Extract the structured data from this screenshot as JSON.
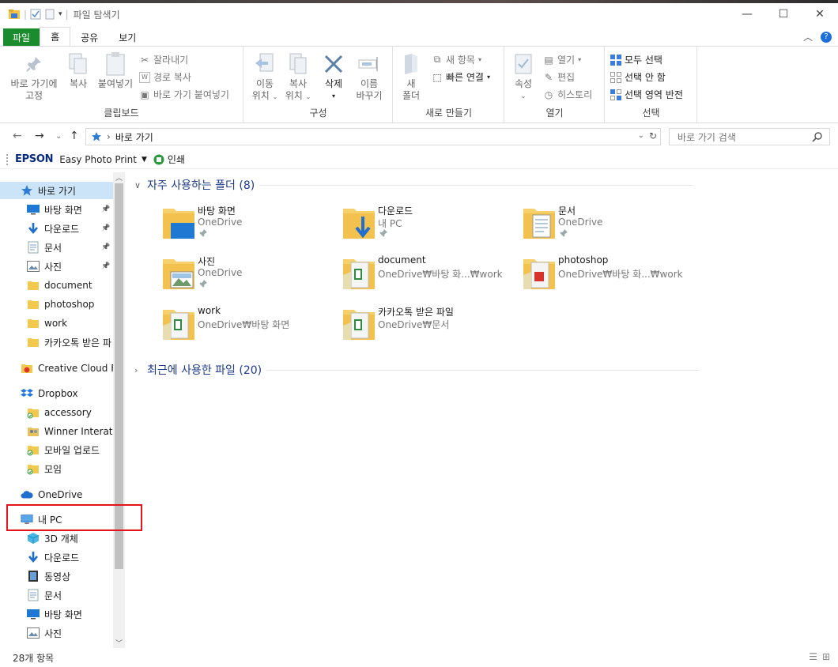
{
  "window": {
    "title": "파일 탐색기"
  },
  "ribbon_tabs": [
    "파일",
    "홈",
    "공유",
    "보기"
  ],
  "ribbon": {
    "clipboard": {
      "label": "클립보드",
      "pin_quick_line1": "바로 가기에",
      "pin_quick_line2": "고정",
      "copy": "복사",
      "paste": "붙여넣기",
      "cut": "잘라내기",
      "copy_path": "경로 복사",
      "paste_shortcut": "바로 가기 붙여넣기"
    },
    "organize": {
      "label": "구성",
      "move_line1": "이동",
      "move_line2": "위치",
      "copyto_line1": "복사",
      "copyto_line2": "위치",
      "delete": "삭제",
      "rename_line1": "이름",
      "rename_line2": "바꾸기"
    },
    "new": {
      "label": "새로 만들기",
      "new_folder_line1": "새",
      "new_folder_line2": "폴더",
      "new_item": "새 항목",
      "easy_access": "빠른 연결"
    },
    "open": {
      "label": "열기",
      "properties": "속성",
      "open": "열기",
      "edit": "편집",
      "history": "히스토리"
    },
    "select": {
      "label": "선택",
      "select_all": "모두 선택",
      "select_none": "선택 안 함",
      "invert": "선택 영역 반전"
    }
  },
  "address": {
    "path": "바로 가기",
    "search_placeholder": "바로 가기 검색"
  },
  "epson_bar": {
    "brand": "EPSON",
    "app": "Easy Photo Print",
    "print": "인쇄"
  },
  "nav_pane": [
    {
      "label": "바로 가기",
      "icon": "quick-access-star-icon",
      "indent": 0,
      "pinned": false,
      "selected": true
    },
    {
      "label": "바탕 화면",
      "icon": "desktop-icon",
      "indent": 1,
      "pinned": true
    },
    {
      "label": "다운로드",
      "icon": "download-arrow-icon",
      "indent": 1,
      "pinned": true
    },
    {
      "label": "문서",
      "icon": "document-icon",
      "indent": 1,
      "pinned": true
    },
    {
      "label": "사진",
      "icon": "pictures-icon",
      "indent": 1,
      "pinned": true
    },
    {
      "label": "document",
      "icon": "folder-icon",
      "indent": 1,
      "pinned": false
    },
    {
      "label": "photoshop",
      "icon": "folder-icon",
      "indent": 1,
      "pinned": false
    },
    {
      "label": "work",
      "icon": "folder-icon",
      "indent": 1,
      "pinned": false
    },
    {
      "label": "카카오톡 받은 파",
      "icon": "folder-icon",
      "indent": 1,
      "pinned": false
    },
    {
      "label": "Creative Cloud Fil",
      "icon": "creative-cloud-icon",
      "indent": 0,
      "pinned": false
    },
    {
      "label": "Dropbox",
      "icon": "dropbox-icon",
      "indent": 0,
      "pinned": false
    },
    {
      "label": "accessory",
      "icon": "synced-folder-icon",
      "indent": 1,
      "pinned": false
    },
    {
      "label": "Winner Interatio",
      "icon": "shared-folder-icon",
      "indent": 1,
      "pinned": false
    },
    {
      "label": "모바일 업로드",
      "icon": "synced-folder-icon",
      "indent": 1,
      "pinned": false
    },
    {
      "label": "모임",
      "icon": "synced-folder-icon",
      "indent": 1,
      "pinned": false
    },
    {
      "label": "OneDrive",
      "icon": "onedrive-cloud-icon",
      "indent": 0,
      "pinned": false
    },
    {
      "label": "내 PC",
      "icon": "this-pc-monitor-icon",
      "indent": 0,
      "pinned": false
    },
    {
      "label": "3D 개체",
      "icon": "3d-objects-icon",
      "indent": 1,
      "pinned": false
    },
    {
      "label": "다운로드",
      "icon": "download-arrow-icon",
      "indent": 1,
      "pinned": false
    },
    {
      "label": "동영상",
      "icon": "video-icon",
      "indent": 1,
      "pinned": false
    },
    {
      "label": "문서",
      "icon": "document-icon",
      "indent": 1,
      "pinned": false
    },
    {
      "label": "바탕 화면",
      "icon": "desktop-icon",
      "indent": 1,
      "pinned": false
    },
    {
      "label": "사진",
      "icon": "pictures-icon",
      "indent": 1,
      "pinned": false
    }
  ],
  "frequent": {
    "heading": "자주 사용하는 폴더 (8)",
    "folders": [
      {
        "name": "바탕 화면",
        "location": "OneDrive",
        "pinned": true,
        "icon": "desktop-folder-icon"
      },
      {
        "name": "다운로드",
        "location": "내 PC",
        "pinned": true,
        "icon": "downloads-folder-icon"
      },
      {
        "name": "문서",
        "location": "OneDrive",
        "pinned": true,
        "icon": "documents-folder-icon"
      },
      {
        "name": "사진",
        "location": "OneDrive",
        "pinned": true,
        "icon": "pictures-folder-icon"
      },
      {
        "name": "document",
        "location": "OneDrive₩바탕 화...₩work",
        "pinned": false,
        "icon": "excel-folder-icon"
      },
      {
        "name": "photoshop",
        "location": "OneDrive₩바탕 화...₩work",
        "pinned": false,
        "icon": "pdf-folder-icon"
      },
      {
        "name": "work",
        "location": "OneDrive₩바탕 화면",
        "pinned": false,
        "icon": "excel-folder-icon"
      },
      {
        "name": "카카오톡 받은 파일",
        "location": "OneDrive₩문서",
        "pinned": false,
        "icon": "excel-folder-icon"
      }
    ]
  },
  "recent": {
    "heading": "최근에 사용한 파일 (20)"
  },
  "status": {
    "count": "28개 항목"
  },
  "colors": {
    "file_tab": "#1b8c2d",
    "selection": "#cce4f7",
    "heading": "#1e3a8a",
    "highlight_box": "#e8121b"
  }
}
